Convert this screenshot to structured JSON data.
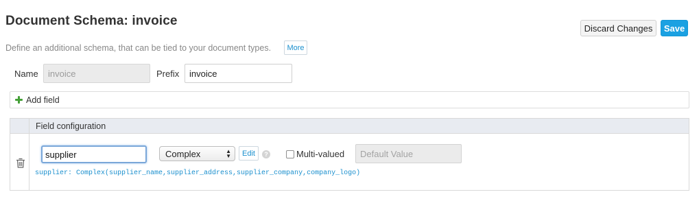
{
  "header": {
    "title": "Document Schema: invoice",
    "discard_label": "Discard Changes",
    "save_label": "Save"
  },
  "description": {
    "text": "Define an additional schema, that can be tied to your document types.",
    "more_label": "More"
  },
  "form": {
    "name_label": "Name",
    "name_value": "invoice",
    "prefix_label": "Prefix",
    "prefix_value": "invoice"
  },
  "add_field": {
    "label": "Add field",
    "icon": "plus-icon"
  },
  "fields_table": {
    "header": "Field configuration",
    "rows": [
      {
        "name_value": "supplier",
        "type_value": "Complex",
        "edit_label": "Edit",
        "help_icon": "?",
        "multivalued_label": "Multi-valued",
        "multivalued_checked": false,
        "default_placeholder": "Default Value",
        "schema_text": "supplier: Complex(supplier_name,supplier_address,supplier_company,company_logo)"
      }
    ]
  },
  "colors": {
    "accent": "#1ba1e2",
    "link": "#1a8fce",
    "add_icon": "#44a037",
    "table_header_bg": "#e8ebf1"
  }
}
